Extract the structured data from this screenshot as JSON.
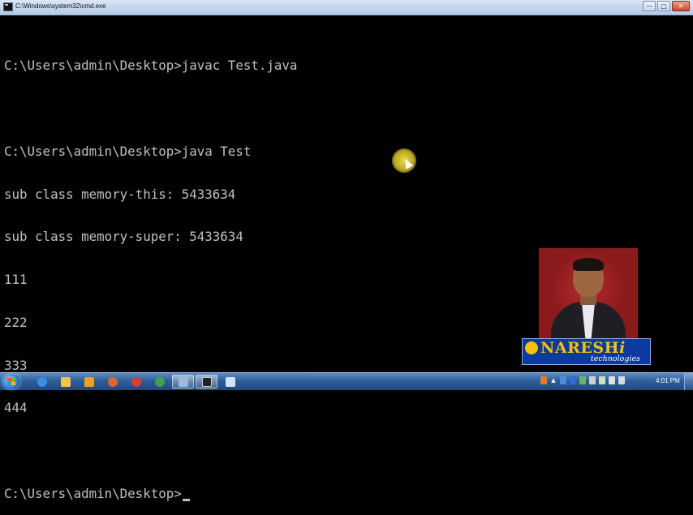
{
  "window": {
    "title": "C:\\Windows\\system32\\cmd.exe",
    "minimize": "—",
    "maximize": "□",
    "close": "✕"
  },
  "console": {
    "lines": [
      "",
      "C:\\Users\\admin\\Desktop>javac Test.java",
      "",
      "C:\\Users\\admin\\Desktop>java Test",
      "sub class memory-this: 5433634",
      "sub class memory-super: 5433634",
      "111",
      "222",
      "333",
      "444",
      "",
      "C:\\Users\\admin\\Desktop>"
    ]
  },
  "overlay": {
    "logo_name": "NARESH",
    "logo_suffix": "i",
    "logo_sub": "technologies"
  },
  "taskbar": {
    "items": [
      {
        "icon": "ie-icon",
        "color": "#3a8ee6"
      },
      {
        "icon": "folder-icon",
        "color": "#f1c54b"
      },
      {
        "icon": "media-player-icon",
        "color": "#f0a020"
      },
      {
        "icon": "firefox-icon",
        "color": "#e2662a"
      },
      {
        "icon": "chrome-icon",
        "color": "#d6402f"
      },
      {
        "icon": "chrome-icon",
        "color": "#3fa34d"
      },
      {
        "icon": "screen-recorder-icon",
        "color": "#9db8d8"
      },
      {
        "icon": "cmd-icon",
        "color": "#222222"
      },
      {
        "icon": "notepad-icon",
        "color": "#cfe3f5"
      }
    ],
    "clock": "4:01 PM"
  }
}
